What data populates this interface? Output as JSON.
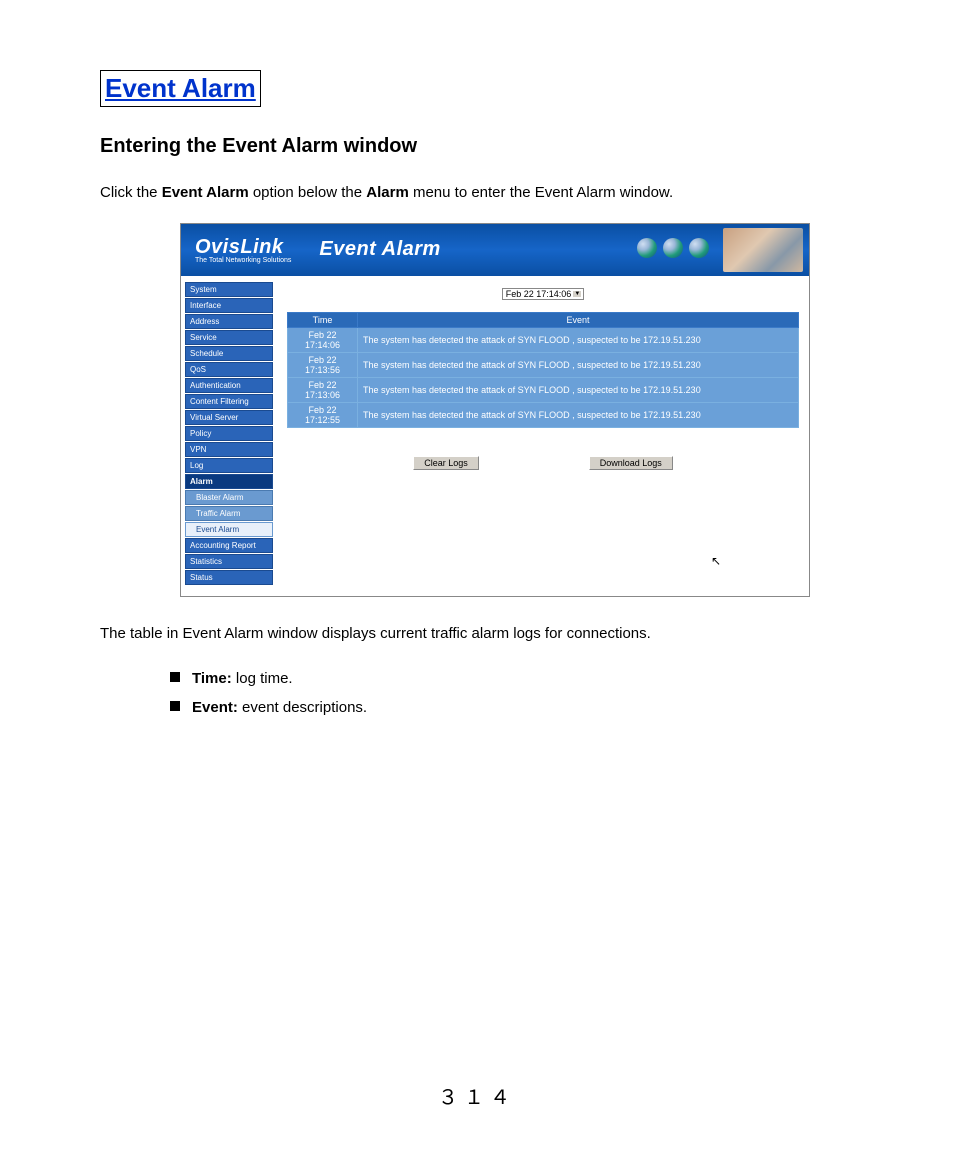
{
  "title": "Event Alarm",
  "subtitle": "Entering the Event Alarm window",
  "intro_prefix": "Click the ",
  "intro_bold1": "Event Alarm",
  "intro_mid": " option below the ",
  "intro_bold2": "Alarm",
  "intro_suffix": " menu to enter the Event Alarm window.",
  "after_para": "The table in Event Alarm window displays current traffic alarm logs for connections.",
  "bullets": [
    {
      "label": "Time:",
      "desc": " log time."
    },
    {
      "label": "Event:",
      "desc": " event descriptions."
    }
  ],
  "page_number": "３１４",
  "screenshot": {
    "logo": "OvisLink",
    "logo_sub": "The Total Networking Solutions",
    "page_title": "Event Alarm",
    "selector_value": "Feb 22 17:14:06",
    "sidebar": [
      {
        "label": "System",
        "type": "item"
      },
      {
        "label": "Interface",
        "type": "item"
      },
      {
        "label": "Address",
        "type": "item"
      },
      {
        "label": "Service",
        "type": "item"
      },
      {
        "label": "Schedule",
        "type": "item"
      },
      {
        "label": "QoS",
        "type": "item"
      },
      {
        "label": "Authentication",
        "type": "item"
      },
      {
        "label": "Content Filtering",
        "type": "item"
      },
      {
        "label": "Virtual Server",
        "type": "item"
      },
      {
        "label": "Policy",
        "type": "item"
      },
      {
        "label": "VPN",
        "type": "item"
      },
      {
        "label": "Log",
        "type": "item"
      },
      {
        "label": "Alarm",
        "type": "active"
      },
      {
        "label": "Blaster Alarm",
        "type": "sub"
      },
      {
        "label": "Traffic Alarm",
        "type": "sub"
      },
      {
        "label": "Event Alarm",
        "type": "sub-selected"
      },
      {
        "label": "Accounting Report",
        "type": "item"
      },
      {
        "label": "Statistics",
        "type": "item"
      },
      {
        "label": "Status",
        "type": "item"
      }
    ],
    "table_headers": {
      "time": "Time",
      "event": "Event"
    },
    "rows": [
      {
        "date": "Feb 22",
        "time": "17:14:06",
        "event": "The system has detected the attack of SYN FLOOD , suspected to be 172.19.51.230"
      },
      {
        "date": "Feb 22",
        "time": "17:13:56",
        "event": "The system has detected the attack of SYN FLOOD , suspected to be 172.19.51.230"
      },
      {
        "date": "Feb 22",
        "time": "17:13:06",
        "event": "The system has detected the attack of SYN FLOOD , suspected to be 172.19.51.230"
      },
      {
        "date": "Feb 22",
        "time": "17:12:55",
        "event": "The system has detected the attack of SYN FLOOD , suspected to be 172.19.51.230"
      }
    ],
    "buttons": {
      "clear": "Clear Logs",
      "download": "Download Logs"
    }
  }
}
